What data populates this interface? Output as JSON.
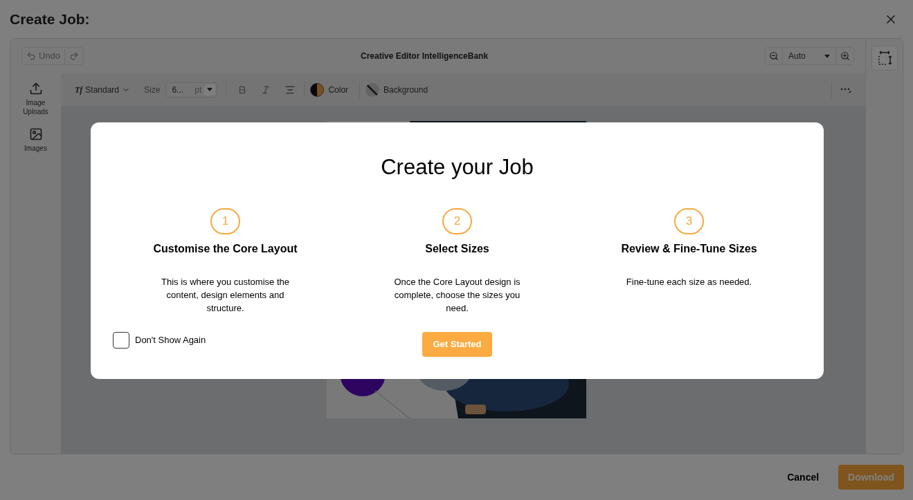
{
  "dialog": {
    "title": "Create Job:"
  },
  "editor": {
    "title": "Creative Editor IntelligenceBank",
    "undo": "Undo",
    "zoom": "Auto"
  },
  "sidebar": {
    "items": [
      {
        "kind": "upload",
        "label": "Image Uploads"
      },
      {
        "kind": "images",
        "label": "Images"
      }
    ]
  },
  "toolbar": {
    "font_icon": "Tf",
    "font": "Standard",
    "size_label": "Size",
    "size_value": "6...",
    "size_unit": "pt",
    "color_label": "Color",
    "background_label": "Background"
  },
  "modal": {
    "title": "Create your Job",
    "steps": [
      {
        "number": "1",
        "title": "Customise the Core Layout",
        "description": "This is where you customise the content, design elements and structure."
      },
      {
        "number": "2",
        "title": "Select Sizes",
        "description": "Once the Core Layout design is complete, choose the sizes you need."
      },
      {
        "number": "3",
        "title": "Review & Fine-Tune Sizes",
        "description": "Fine-tune each size as needed."
      }
    ],
    "dont_show": {
      "label": "Don't Show Again",
      "checked": false
    },
    "button": "Get Started"
  },
  "footer": {
    "cancel": "Cancel",
    "download": "Download"
  }
}
